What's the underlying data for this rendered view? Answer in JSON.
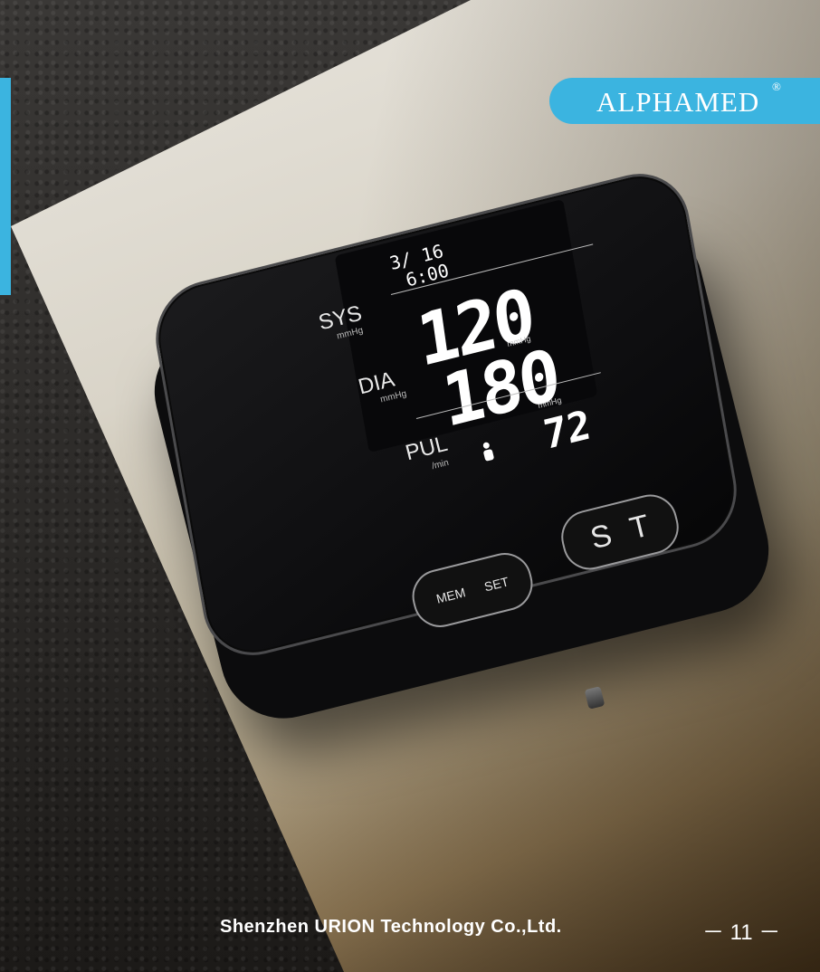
{
  "brand": {
    "name": "ALPHAMED",
    "registered": "®"
  },
  "display": {
    "date": "3/ 16",
    "time": "6:00",
    "sys_label": "SYS",
    "sys_unit": "mmHg",
    "sys_value": "120",
    "sys_value_unit": "mmHg",
    "dia_label": "DIA",
    "dia_unit": "mmHg",
    "dia_value": "180",
    "dia_value_unit": "mmHg",
    "pul_label": "PUL",
    "pul_unit": "/min",
    "pul_value": "72"
  },
  "buttons": {
    "mem": "MEM",
    "set": "SET",
    "s": "S",
    "t": "T"
  },
  "footer": {
    "company": "Shenzhen URION Technology Co.,Ltd.",
    "page": "－ 11 －"
  },
  "colors": {
    "accent": "#3bb4e0"
  },
  "icons": {
    "user": "person-icon"
  }
}
